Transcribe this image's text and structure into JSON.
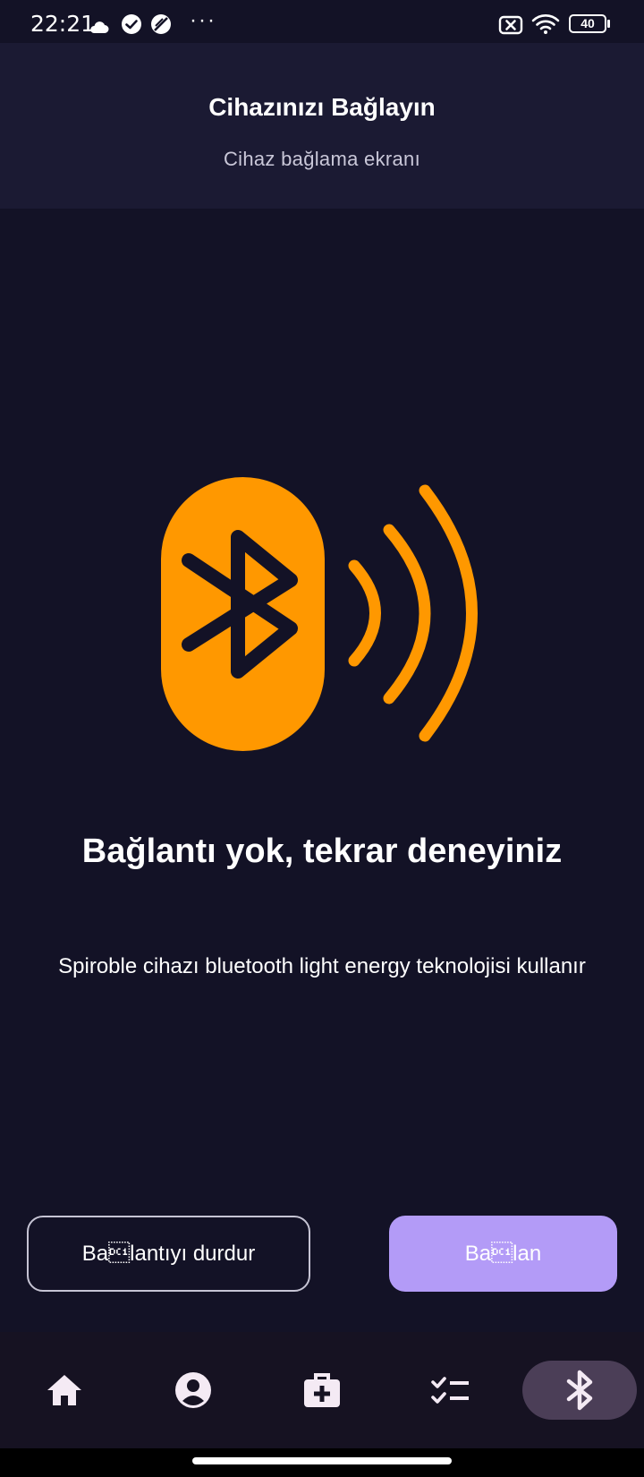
{
  "status_bar": {
    "time": "22:21",
    "more": "···",
    "battery_level": "40",
    "icons": [
      "cloud-icon",
      "check-circle-icon",
      "no-disturb-icon",
      "sim-off-icon",
      "wifi-icon",
      "battery-icon"
    ]
  },
  "header": {
    "title": "Cihazınızı Bağlayın",
    "subtitle": "Cihaz bağlama ekranı"
  },
  "illustration": {
    "icon": "bluetooth-broadcast-icon",
    "accent_color": "#ff9800"
  },
  "message": {
    "title": "Bağlantı yok, tekrar deneyiniz",
    "body": "Spiroble cihazı bluetooth light energy teknolojisi kullanır"
  },
  "buttons": {
    "stop_label": "Ba\u0011lantıyı durdur",
    "connect_label": "Ba\u0011lan"
  },
  "bottom_nav": {
    "items": [
      {
        "icon": "home-icon",
        "active": false
      },
      {
        "icon": "profile-icon",
        "active": false
      },
      {
        "icon": "medical-kit-icon",
        "active": false
      },
      {
        "icon": "checklist-icon",
        "active": false
      },
      {
        "icon": "bluetooth-icon",
        "active": true
      }
    ]
  },
  "colors": {
    "background": "#131226",
    "header_background": "#1b1a33",
    "accent": "#ff9800",
    "primary_button": "#b39bf7",
    "nav_active": "#4b3e57"
  }
}
